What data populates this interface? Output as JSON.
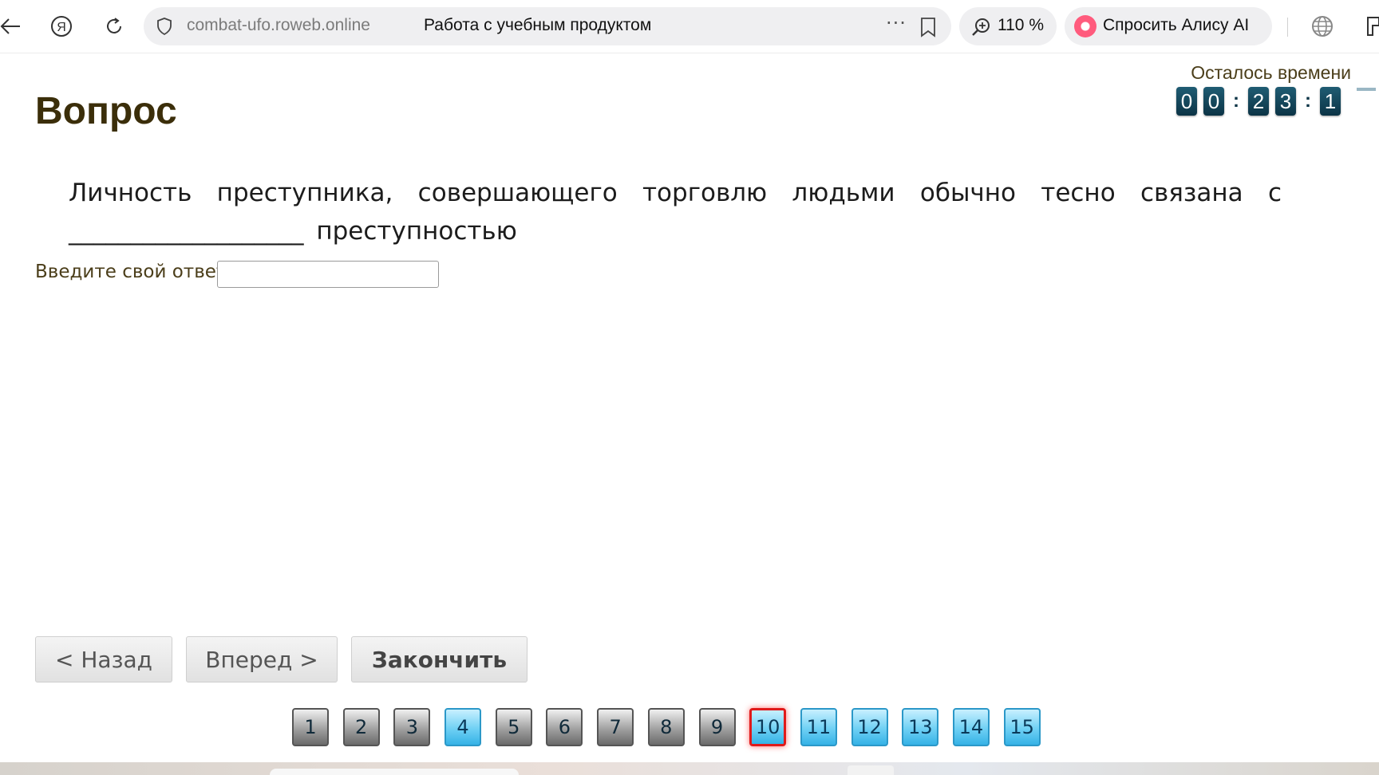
{
  "browser": {
    "domain": "combat-ufo.roweb.online",
    "page_title": "Работа с учебным продуктом",
    "more": "···",
    "zoom": "110 %",
    "alice_label": "Спросить Алису AI"
  },
  "page": {
    "title": "Вопрос",
    "timer_label": "Осталось времени",
    "timer_digits": [
      "0",
      "0",
      "2",
      "3",
      "1"
    ],
    "timer_separator": ":",
    "question": "Личность преступника, совершающего торговлю людьми обычно тесно связана с ___________________ преступностью",
    "answer_label": "Введите свой ответ",
    "answer_value": ""
  },
  "buttons": {
    "back": "< Назад",
    "forward": "Вперед >",
    "finish": "Закончить"
  },
  "pagination": [
    {
      "label": "1",
      "state": "visited"
    },
    {
      "label": "2",
      "state": "visited"
    },
    {
      "label": "3",
      "state": "visited"
    },
    {
      "label": "4",
      "state": "fresh"
    },
    {
      "label": "5",
      "state": "visited"
    },
    {
      "label": "6",
      "state": "visited"
    },
    {
      "label": "7",
      "state": "visited"
    },
    {
      "label": "8",
      "state": "visited"
    },
    {
      "label": "9",
      "state": "visited"
    },
    {
      "label": "10",
      "state": "current"
    },
    {
      "label": "11",
      "state": "fresh"
    },
    {
      "label": "12",
      "state": "fresh"
    },
    {
      "label": "13",
      "state": "fresh"
    },
    {
      "label": "14",
      "state": "fresh"
    },
    {
      "label": "15",
      "state": "fresh"
    }
  ],
  "colors": {
    "title": "#3b2e0a",
    "timer_digit_bg": "#0c3446",
    "current_page_border": "#e01a1a",
    "fresh_page": "#35b2e6",
    "visited_page": "#6a6a6a"
  }
}
